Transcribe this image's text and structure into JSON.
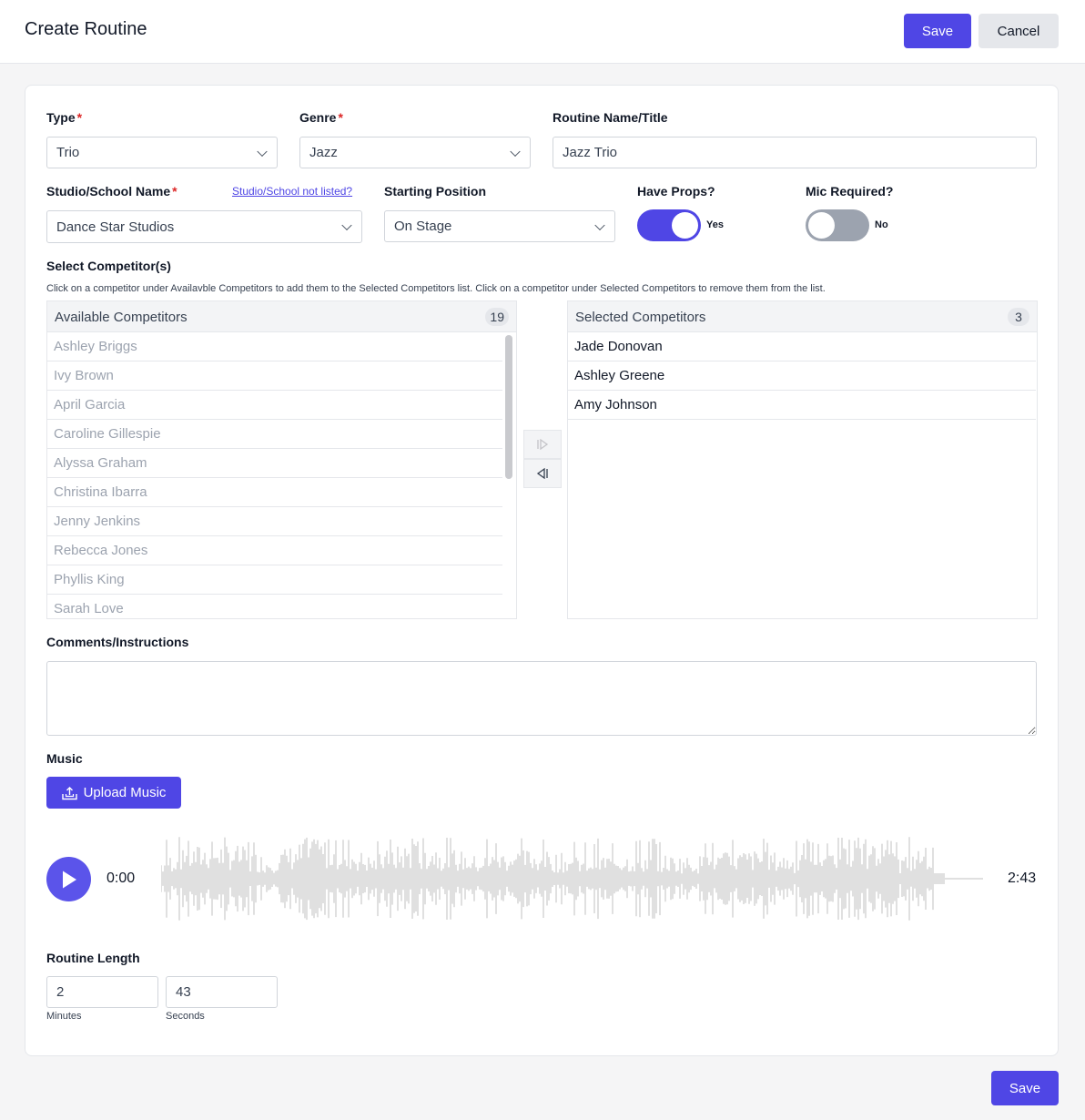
{
  "header": {
    "title": "Create Routine",
    "save_label": "Save",
    "cancel_label": "Cancel"
  },
  "form": {
    "type": {
      "label": "Type",
      "required_mark": "*",
      "value": "Trio"
    },
    "genre": {
      "label": "Genre",
      "required_mark": "*",
      "value": "Jazz"
    },
    "routine_name": {
      "label": "Routine Name/Title",
      "value": "Jazz Trio"
    },
    "studio": {
      "label": "Studio/School Name",
      "required_mark": "*",
      "value": "Dance Star Studios",
      "not_listed_link": "Studio/School not listed?"
    },
    "starting_position": {
      "label": "Starting Position",
      "value": "On Stage"
    },
    "props": {
      "label": "Have Props?",
      "state_text": "Yes",
      "on": true
    },
    "mic": {
      "label": "Mic Required?",
      "state_text": "No",
      "on": false
    },
    "competitors": {
      "label": "Select Competitor(s)",
      "hint": "Click on a competitor under Availavble Competitors to add them to the Selected Competitors list. Click on a competitor under Selected Competitors to remove them from the list.",
      "available_title": "Available Competitors",
      "available_count": "19",
      "available": [
        "Ashley Briggs",
        "Ivy Brown",
        "April Garcia",
        "Caroline Gillespie",
        "Alyssa Graham",
        "Christina Ibarra",
        "Jenny Jenkins",
        "Rebecca Jones",
        "Phyllis King",
        "Sarah Love"
      ],
      "selected_title": "Selected Competitors",
      "selected_count": "3",
      "selected": [
        "Jade Donovan",
        "Ashley Greene",
        "Amy Johnson"
      ]
    },
    "comments": {
      "label": "Comments/Instructions",
      "value": ""
    },
    "music": {
      "label": "Music",
      "upload_label": "Upload Music",
      "current_time": "0:00",
      "duration": "2:43",
      "waveform_color": "#d9d9d9"
    },
    "routine_length": {
      "label": "Routine Length",
      "minutes": "2",
      "minutes_label": "Minutes",
      "seconds": "43",
      "seconds_label": "Seconds"
    }
  },
  "footer": {
    "save_label": "Save"
  },
  "colors": {
    "accent": "#4f46e5",
    "required": "#dc2626",
    "toggle_off": "#9ca3af"
  }
}
